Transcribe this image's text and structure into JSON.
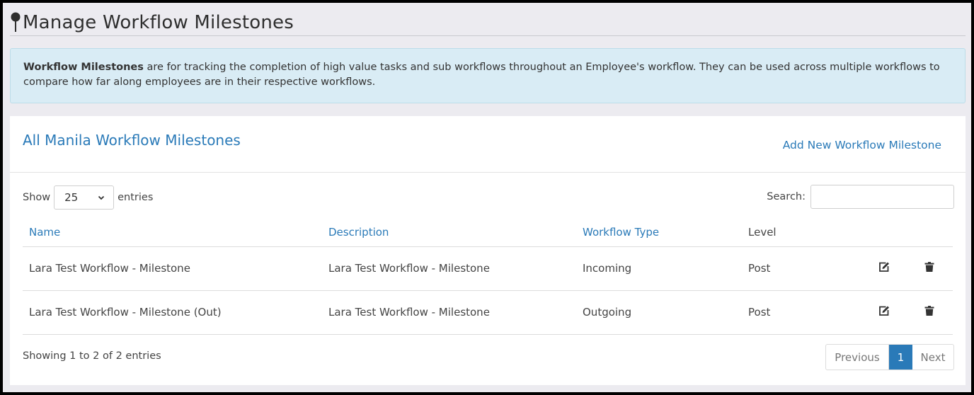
{
  "page": {
    "title": "Manage Workflow Milestones"
  },
  "alert": {
    "bold": "Workflow Milestones",
    "text": " are for tracking the completion of high value tasks and sub workflows throughout an Employee's workflow. They can be used across multiple workflows to compare how far along employees are in their respective workflows."
  },
  "card": {
    "title": "All Manila Workflow Milestones",
    "add_link": "Add New Workflow Milestone"
  },
  "controls": {
    "show_label": "Show",
    "page_size": "25",
    "entries_label": "entries",
    "search_label": "Search:"
  },
  "table": {
    "columns": [
      "Name",
      "Description",
      "Workflow Type",
      "Level"
    ],
    "rows": [
      {
        "name": "Lara Test Workflow - Milestone",
        "description": "Lara Test Workflow - Milestone",
        "type": "Incoming",
        "level": "Post"
      },
      {
        "name": "Lara Test Workflow - Milestone (Out)",
        "description": "Lara Test Workflow - Milestone",
        "type": "Outgoing",
        "level": "Post"
      }
    ]
  },
  "footer": {
    "info": "Showing 1 to 2 of 2 entries",
    "previous": "Previous",
    "current_page": "1",
    "next": "Next"
  },
  "icons": {
    "title": "map-pin-icon",
    "edit": "edit-icon",
    "delete": "trash-icon",
    "select": "chevron-down-icon"
  },
  "colors": {
    "accent": "#2a7ab8",
    "alert_bg": "#d9ecf5",
    "page_bg": "#ecebf0"
  }
}
